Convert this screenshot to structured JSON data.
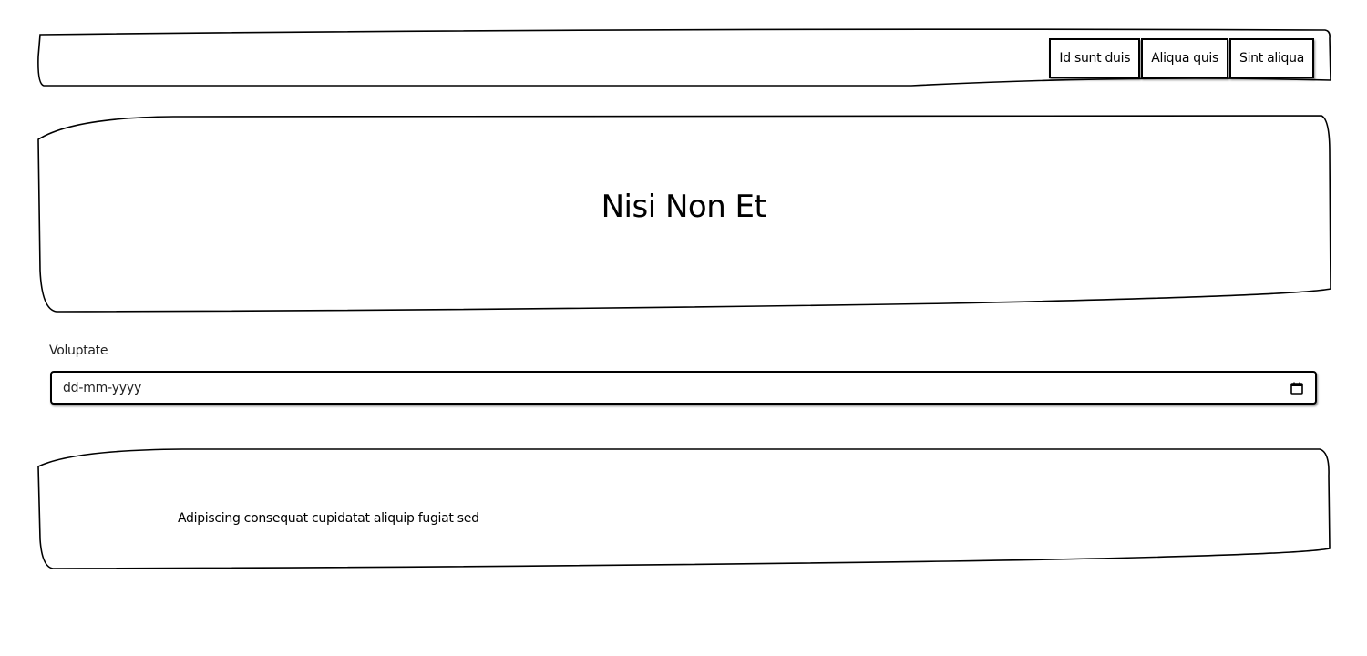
{
  "header": {
    "nav": [
      {
        "label": "Id sunt duis"
      },
      {
        "label": "Aliqua quis"
      },
      {
        "label": "Sint aliqua"
      }
    ]
  },
  "hero": {
    "title": "Nisi Non Et"
  },
  "form": {
    "date_label": "Voluptate",
    "date_value": "dd-mm-yyyy",
    "date_icon": "calendar-icon"
  },
  "card": {
    "text": "Adipiscing consequat cupidatat aliquip fugiat sed"
  },
  "colors": {
    "stroke": "#000000",
    "background": "#ffffff"
  }
}
